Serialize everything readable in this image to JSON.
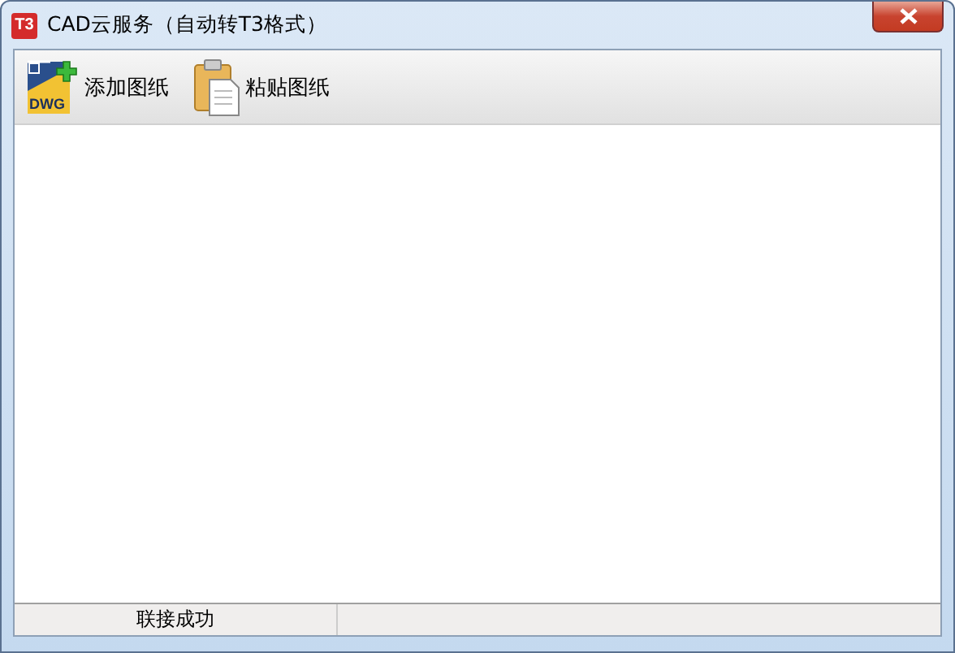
{
  "window": {
    "title": "CAD云服务（自动转T3格式）",
    "app_icon_text": "T3"
  },
  "toolbar": [
    {
      "kind": "dwg",
      "label": "添加图纸",
      "icon_text": "DWG"
    },
    {
      "kind": "paste",
      "label": "粘贴图纸"
    }
  ],
  "status_bar": {
    "text": "联接成功"
  }
}
